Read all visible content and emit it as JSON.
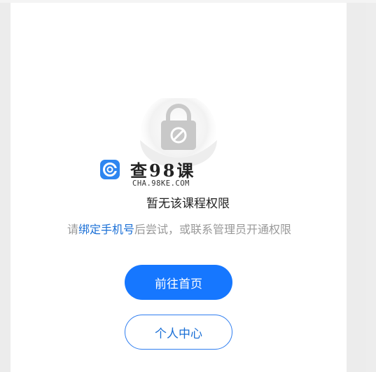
{
  "watermark": {
    "title": "查98课",
    "subtitle": "CHA.98KE.COM",
    "badge_icon": "logo-c-icon"
  },
  "status": {
    "icon": "lock-icon",
    "message": "暂无该课程权限"
  },
  "hint": {
    "prefix": "请",
    "link": "绑定手机号",
    "suffix": "后尝试，或联系管理员开通权限"
  },
  "buttons": {
    "home": "前往首页",
    "profile": "个人中心"
  },
  "colors": {
    "primary": "#1677ff",
    "link": "#1a6fd6",
    "hint_text": "#999999",
    "watermark_badge": "#2e86f0"
  }
}
